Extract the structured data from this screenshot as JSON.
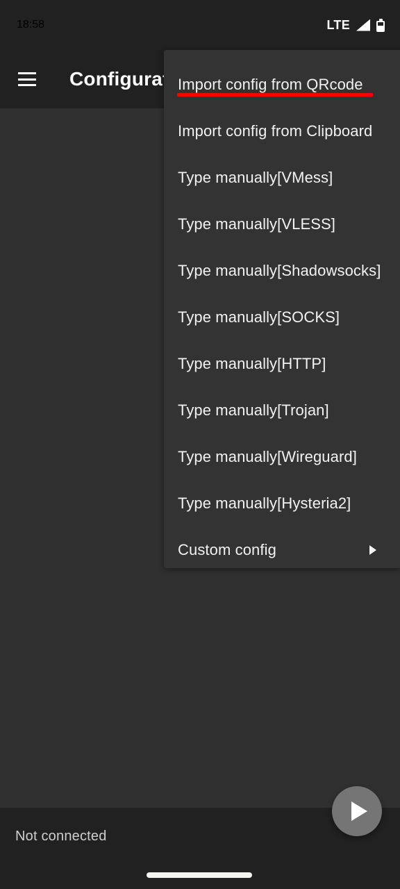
{
  "status_bar": {
    "clock": "18:58",
    "network_label": "LTE",
    "signal_icon": "signal-triangle-icon",
    "battery_icon": "battery-icon"
  },
  "app_bar": {
    "menu_icon": "hamburger-menu-icon",
    "title": "Configuration"
  },
  "popup_menu": {
    "items": [
      {
        "label": "Import config from QRcode",
        "highlighted": true,
        "underline_color": "#fb0000",
        "has_submenu": false
      },
      {
        "label": "Import config from Clipboard",
        "highlighted": false,
        "has_submenu": false
      },
      {
        "label": "Type manually[VMess]",
        "highlighted": false,
        "has_submenu": false
      },
      {
        "label": "Type manually[VLESS]",
        "highlighted": false,
        "has_submenu": false
      },
      {
        "label": "Type manually[Shadowsocks]",
        "highlighted": false,
        "has_submenu": false
      },
      {
        "label": "Type manually[SOCKS]",
        "highlighted": false,
        "has_submenu": false
      },
      {
        "label": "Type manually[HTTP]",
        "highlighted": false,
        "has_submenu": false
      },
      {
        "label": "Type manually[Trojan]",
        "highlighted": false,
        "has_submenu": false
      },
      {
        "label": "Type manually[Wireguard]",
        "highlighted": false,
        "has_submenu": false
      },
      {
        "label": "Type manually[Hysteria2]",
        "highlighted": false,
        "has_submenu": false
      },
      {
        "label": "Custom config",
        "highlighted": false,
        "has_submenu": true,
        "submenu_icon": "chevron-right-icon"
      }
    ]
  },
  "bottom_bar": {
    "connection_status": "Not connected"
  },
  "fab": {
    "icon": "play-icon",
    "color": "#757575"
  },
  "colors": {
    "page_background": "#303030",
    "bar_background": "#212121",
    "menu_background": "#333333",
    "accent_red": "#fb0000",
    "text_primary": "#f2f2f2",
    "text_muted": "#cfcfcf"
  }
}
